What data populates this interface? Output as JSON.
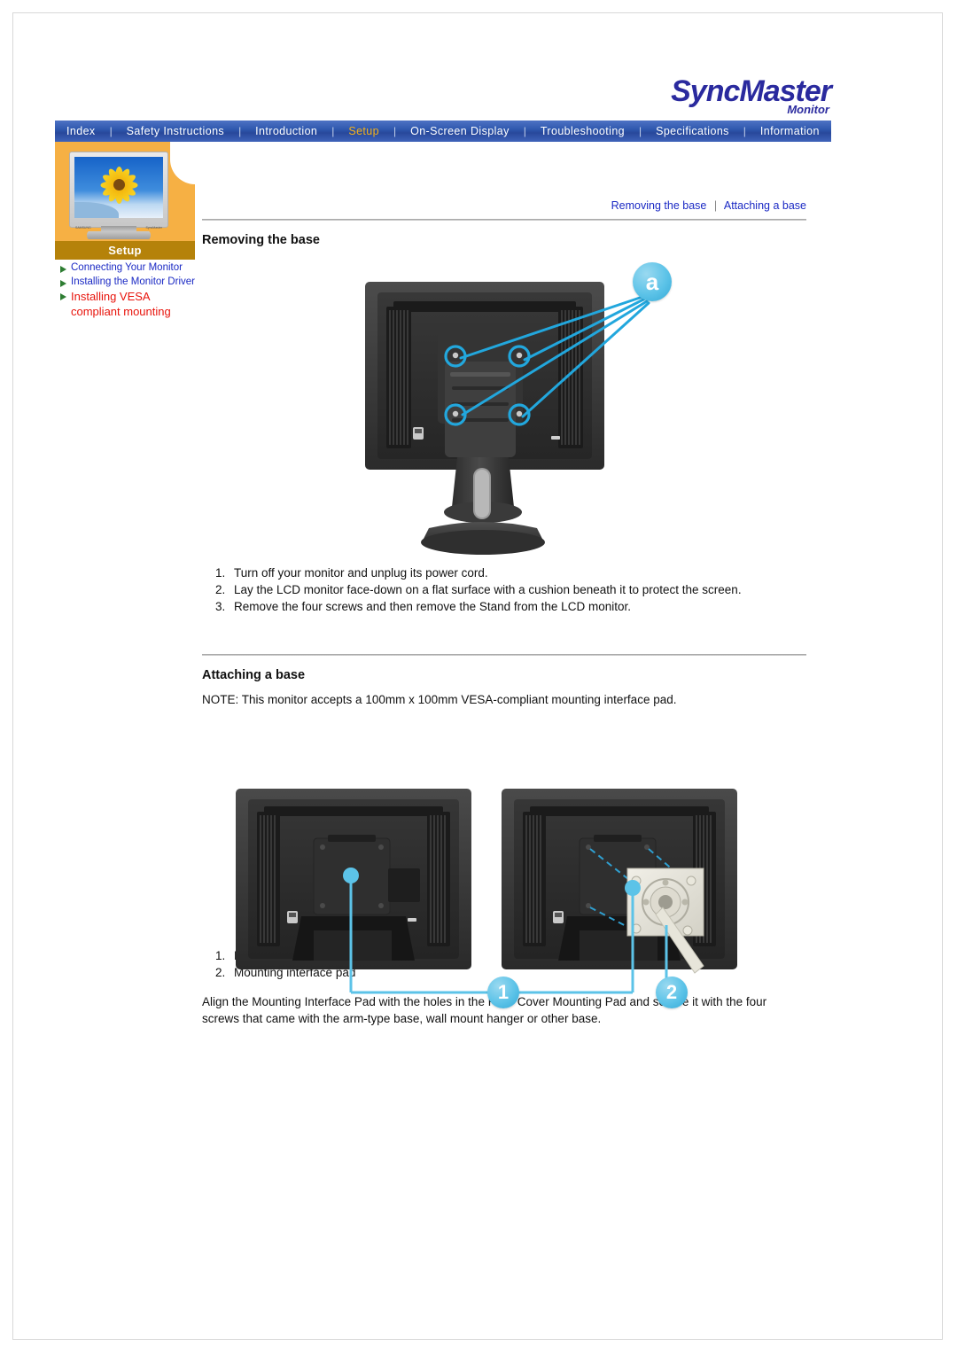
{
  "brand": {
    "name": "SyncMaster",
    "sub": "Monitor"
  },
  "nav": {
    "items": [
      {
        "label": "Index",
        "active": false
      },
      {
        "label": "Safety Instructions",
        "active": false
      },
      {
        "label": "Introduction",
        "active": false
      },
      {
        "label": "Setup",
        "active": true
      },
      {
        "label": "On-Screen Display",
        "active": false
      },
      {
        "label": "Troubleshooting",
        "active": false
      },
      {
        "label": "Specifications",
        "active": false
      },
      {
        "label": "Information",
        "active": false
      }
    ],
    "separator": "|"
  },
  "sidebar": {
    "section_label": "Setup",
    "thumbnail_brand": "SAMSUNG",
    "thumbnail_model": "SyncMaster",
    "items": [
      {
        "label": "Connecting Your Monitor",
        "active": false
      },
      {
        "label": "Installing the Monitor Driver",
        "active": false
      },
      {
        "label": "Installing VESA compliant mounting",
        "active": true
      }
    ]
  },
  "content": {
    "toplinks": [
      {
        "label": "Removing the base"
      },
      {
        "label": "Attaching a base"
      }
    ],
    "toplink_separator": "|",
    "section1": {
      "title": "Removing the base",
      "steps": [
        "Turn off your monitor and unplug its power cord.",
        "Lay the LCD monitor face-down on a flat surface with a cushion beneath it to protect the screen.",
        "Remove the four screws and then remove the Stand from the LCD monitor."
      ]
    },
    "section2": {
      "title": "Attaching a base",
      "note": "NOTE: This monitor accepts a 100mm x 100mm VESA-compliant mounting interface pad.",
      "items": [
        "Rear cover mounting pad",
        "Mounting interface pad"
      ],
      "paragraph": "Align the Mounting Interface Pad with the holes in the Rear Cover Mounting Pad and secure it with the four screws that came with the arm-type base, wall mount hanger or other base."
    }
  },
  "figures": {
    "figure1": {
      "alt": "Rear view of LCD monitor with stand, four screw holes circled",
      "callouts": [
        {
          "label": "a"
        }
      ]
    },
    "figure2": {
      "alt": "Rear cover mounting pad and mounting interface pad attachment",
      "callouts": [
        {
          "label": "1"
        },
        {
          "label": "2"
        }
      ]
    }
  },
  "colors": {
    "nav_background": "#2f58ae",
    "nav_active_text": "#f5b21a",
    "sidebar_panel": "#f6b044",
    "setup_bar": "#b5820a",
    "link_blue": "#1a29c4",
    "active_red": "#e8140c",
    "callout_cyan": "#5cc3e8",
    "brand_blue": "#2a2a9e"
  }
}
